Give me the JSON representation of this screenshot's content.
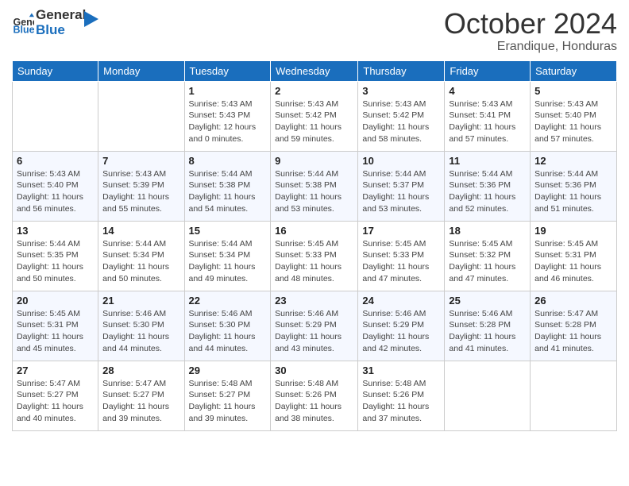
{
  "logo": {
    "text_general": "General",
    "text_blue": "Blue"
  },
  "title": "October 2024",
  "location": "Erandique, Honduras",
  "days_of_week": [
    "Sunday",
    "Monday",
    "Tuesday",
    "Wednesday",
    "Thursday",
    "Friday",
    "Saturday"
  ],
  "weeks": [
    [
      {
        "day": "",
        "sunrise": "",
        "sunset": "",
        "daylight": ""
      },
      {
        "day": "",
        "sunrise": "",
        "sunset": "",
        "daylight": ""
      },
      {
        "day": "1",
        "sunrise": "Sunrise: 5:43 AM",
        "sunset": "Sunset: 5:43 PM",
        "daylight": "Daylight: 12 hours and 0 minutes."
      },
      {
        "day": "2",
        "sunrise": "Sunrise: 5:43 AM",
        "sunset": "Sunset: 5:42 PM",
        "daylight": "Daylight: 11 hours and 59 minutes."
      },
      {
        "day": "3",
        "sunrise": "Sunrise: 5:43 AM",
        "sunset": "Sunset: 5:42 PM",
        "daylight": "Daylight: 11 hours and 58 minutes."
      },
      {
        "day": "4",
        "sunrise": "Sunrise: 5:43 AM",
        "sunset": "Sunset: 5:41 PM",
        "daylight": "Daylight: 11 hours and 57 minutes."
      },
      {
        "day": "5",
        "sunrise": "Sunrise: 5:43 AM",
        "sunset": "Sunset: 5:40 PM",
        "daylight": "Daylight: 11 hours and 57 minutes."
      }
    ],
    [
      {
        "day": "6",
        "sunrise": "Sunrise: 5:43 AM",
        "sunset": "Sunset: 5:40 PM",
        "daylight": "Daylight: 11 hours and 56 minutes."
      },
      {
        "day": "7",
        "sunrise": "Sunrise: 5:43 AM",
        "sunset": "Sunset: 5:39 PM",
        "daylight": "Daylight: 11 hours and 55 minutes."
      },
      {
        "day": "8",
        "sunrise": "Sunrise: 5:44 AM",
        "sunset": "Sunset: 5:38 PM",
        "daylight": "Daylight: 11 hours and 54 minutes."
      },
      {
        "day": "9",
        "sunrise": "Sunrise: 5:44 AM",
        "sunset": "Sunset: 5:38 PM",
        "daylight": "Daylight: 11 hours and 53 minutes."
      },
      {
        "day": "10",
        "sunrise": "Sunrise: 5:44 AM",
        "sunset": "Sunset: 5:37 PM",
        "daylight": "Daylight: 11 hours and 53 minutes."
      },
      {
        "day": "11",
        "sunrise": "Sunrise: 5:44 AM",
        "sunset": "Sunset: 5:36 PM",
        "daylight": "Daylight: 11 hours and 52 minutes."
      },
      {
        "day": "12",
        "sunrise": "Sunrise: 5:44 AM",
        "sunset": "Sunset: 5:36 PM",
        "daylight": "Daylight: 11 hours and 51 minutes."
      }
    ],
    [
      {
        "day": "13",
        "sunrise": "Sunrise: 5:44 AM",
        "sunset": "Sunset: 5:35 PM",
        "daylight": "Daylight: 11 hours and 50 minutes."
      },
      {
        "day": "14",
        "sunrise": "Sunrise: 5:44 AM",
        "sunset": "Sunset: 5:34 PM",
        "daylight": "Daylight: 11 hours and 50 minutes."
      },
      {
        "day": "15",
        "sunrise": "Sunrise: 5:44 AM",
        "sunset": "Sunset: 5:34 PM",
        "daylight": "Daylight: 11 hours and 49 minutes."
      },
      {
        "day": "16",
        "sunrise": "Sunrise: 5:45 AM",
        "sunset": "Sunset: 5:33 PM",
        "daylight": "Daylight: 11 hours and 48 minutes."
      },
      {
        "day": "17",
        "sunrise": "Sunrise: 5:45 AM",
        "sunset": "Sunset: 5:33 PM",
        "daylight": "Daylight: 11 hours and 47 minutes."
      },
      {
        "day": "18",
        "sunrise": "Sunrise: 5:45 AM",
        "sunset": "Sunset: 5:32 PM",
        "daylight": "Daylight: 11 hours and 47 minutes."
      },
      {
        "day": "19",
        "sunrise": "Sunrise: 5:45 AM",
        "sunset": "Sunset: 5:31 PM",
        "daylight": "Daylight: 11 hours and 46 minutes."
      }
    ],
    [
      {
        "day": "20",
        "sunrise": "Sunrise: 5:45 AM",
        "sunset": "Sunset: 5:31 PM",
        "daylight": "Daylight: 11 hours and 45 minutes."
      },
      {
        "day": "21",
        "sunrise": "Sunrise: 5:46 AM",
        "sunset": "Sunset: 5:30 PM",
        "daylight": "Daylight: 11 hours and 44 minutes."
      },
      {
        "day": "22",
        "sunrise": "Sunrise: 5:46 AM",
        "sunset": "Sunset: 5:30 PM",
        "daylight": "Daylight: 11 hours and 44 minutes."
      },
      {
        "day": "23",
        "sunrise": "Sunrise: 5:46 AM",
        "sunset": "Sunset: 5:29 PM",
        "daylight": "Daylight: 11 hours and 43 minutes."
      },
      {
        "day": "24",
        "sunrise": "Sunrise: 5:46 AM",
        "sunset": "Sunset: 5:29 PM",
        "daylight": "Daylight: 11 hours and 42 minutes."
      },
      {
        "day": "25",
        "sunrise": "Sunrise: 5:46 AM",
        "sunset": "Sunset: 5:28 PM",
        "daylight": "Daylight: 11 hours and 41 minutes."
      },
      {
        "day": "26",
        "sunrise": "Sunrise: 5:47 AM",
        "sunset": "Sunset: 5:28 PM",
        "daylight": "Daylight: 11 hours and 41 minutes."
      }
    ],
    [
      {
        "day": "27",
        "sunrise": "Sunrise: 5:47 AM",
        "sunset": "Sunset: 5:27 PM",
        "daylight": "Daylight: 11 hours and 40 minutes."
      },
      {
        "day": "28",
        "sunrise": "Sunrise: 5:47 AM",
        "sunset": "Sunset: 5:27 PM",
        "daylight": "Daylight: 11 hours and 39 minutes."
      },
      {
        "day": "29",
        "sunrise": "Sunrise: 5:48 AM",
        "sunset": "Sunset: 5:27 PM",
        "daylight": "Daylight: 11 hours and 39 minutes."
      },
      {
        "day": "30",
        "sunrise": "Sunrise: 5:48 AM",
        "sunset": "Sunset: 5:26 PM",
        "daylight": "Daylight: 11 hours and 38 minutes."
      },
      {
        "day": "31",
        "sunrise": "Sunrise: 5:48 AM",
        "sunset": "Sunset: 5:26 PM",
        "daylight": "Daylight: 11 hours and 37 minutes."
      },
      {
        "day": "",
        "sunrise": "",
        "sunset": "",
        "daylight": ""
      },
      {
        "day": "",
        "sunrise": "",
        "sunset": "",
        "daylight": ""
      }
    ]
  ]
}
